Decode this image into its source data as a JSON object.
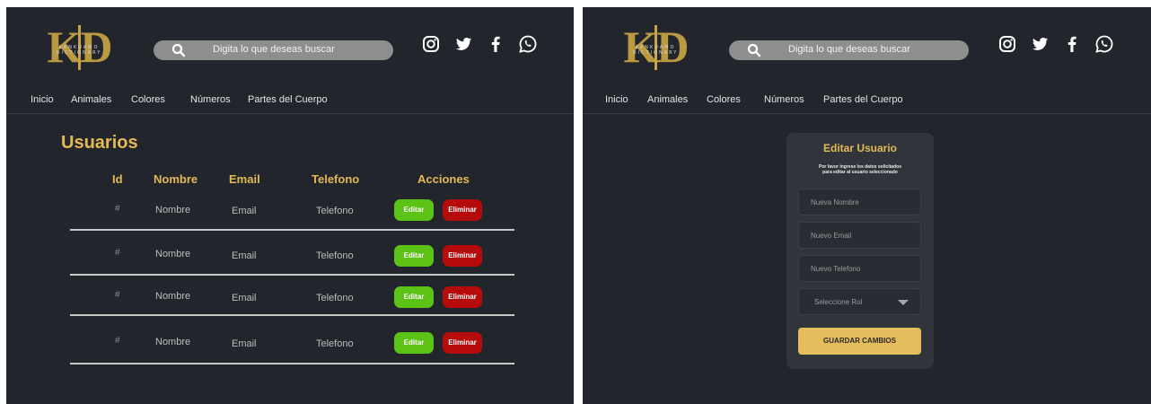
{
  "logo": {
    "letters": "KD",
    "sub1": "KANKUAMO",
    "sub2": "DICTIONARY"
  },
  "search": {
    "placeholder": "Digita lo que deseas buscar"
  },
  "socials": [
    "instagram-icon",
    "twitter-icon",
    "facebook-icon",
    "whatsapp-icon"
  ],
  "nav": {
    "items": [
      "Inicio",
      "Animales",
      "Colores",
      "Números",
      "Partes del Cuerpo"
    ]
  },
  "users": {
    "title": "Usuarios",
    "headers": {
      "id": "Id",
      "name": "Nombre",
      "email": "Email",
      "phone": "Telefono",
      "actions": "Acciones"
    },
    "rows": [
      {
        "id": "#",
        "name": "Nombre",
        "email": "Email",
        "phone": "Telefono",
        "edit": "Editar",
        "delete": "Eliminar"
      },
      {
        "id": "#",
        "name": "Nombre",
        "email": "Email",
        "phone": "Telefono",
        "edit": "Editar",
        "delete": "Eliminar"
      },
      {
        "id": "#",
        "name": "Nombre",
        "email": "Email",
        "phone": "Telefono",
        "edit": "Editar",
        "delete": "Eliminar"
      },
      {
        "id": "#",
        "name": "Nombre",
        "email": "Email",
        "phone": "Telefono",
        "edit": "Editar",
        "delete": "Eliminar"
      }
    ]
  },
  "edit_form": {
    "title": "Editar Usuario",
    "description_line1": "Por favor ingrese los datos solicitados",
    "description_line2": "para editar al usuario seleccionado",
    "name_placeholder": "Nueva Nombre",
    "email_placeholder": "Nuevo Email",
    "phone_placeholder": "Nuevo Telefono",
    "role_placeholder": "Seleccione Rol",
    "save_label": "GUARDAR CAMBIOS"
  },
  "colors": {
    "background": "#23252c",
    "accent": "#e3b954",
    "edit": "#5cc215",
    "delete": "#b60b0b",
    "save": "#e6bd5c"
  }
}
